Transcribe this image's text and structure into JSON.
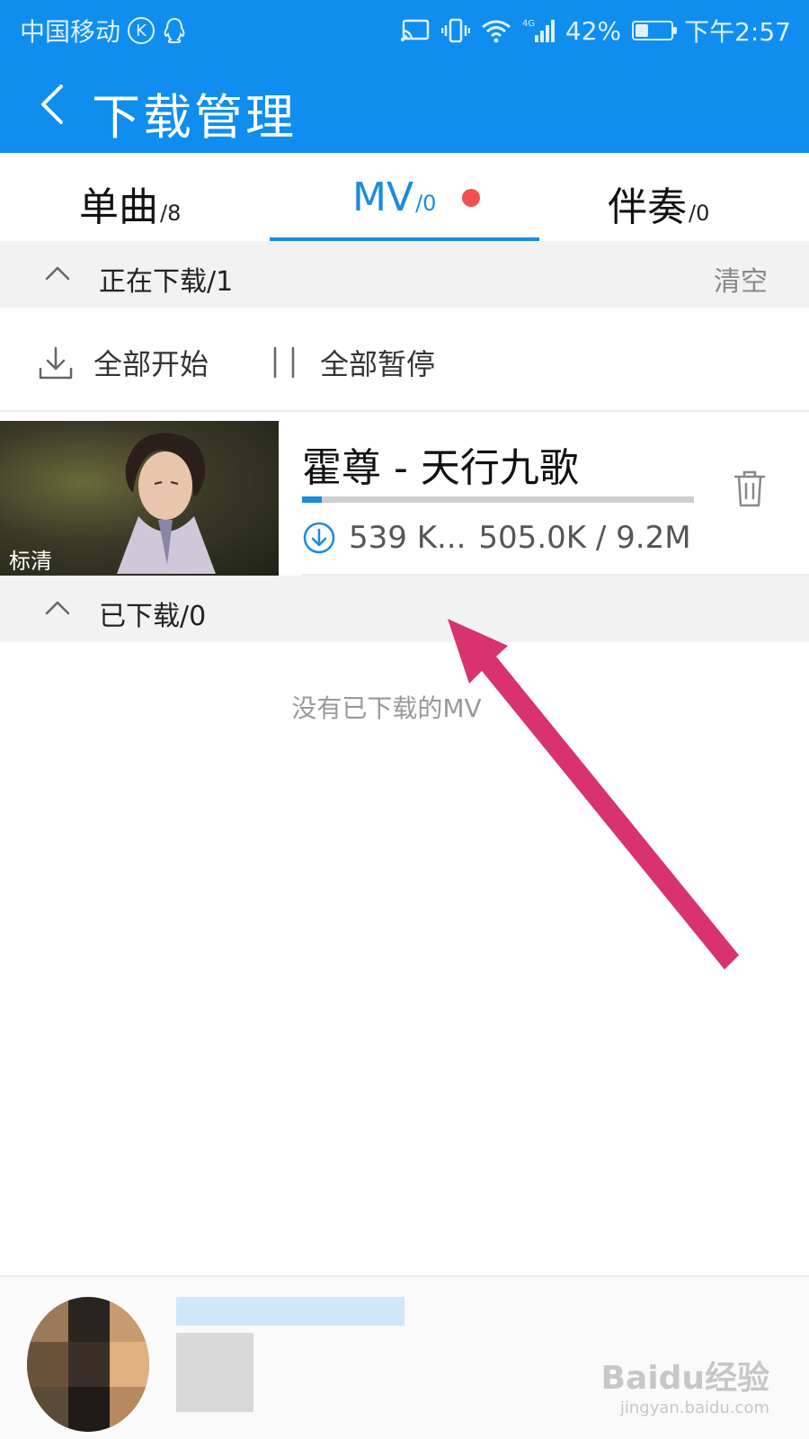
{
  "status_bar": {
    "carrier": "中国移动",
    "k_badge": "K",
    "battery_text": "42%",
    "battery_level": 0.42,
    "time": "下午2:57"
  },
  "title_bar": {
    "title": "下载管理"
  },
  "tabs": [
    {
      "label": "单曲",
      "count": "/8"
    },
    {
      "label": "MV",
      "count": "/0",
      "active": true,
      "has_dot": true
    },
    {
      "label": "伴奏",
      "count": "/0"
    }
  ],
  "downloading_section": {
    "label": "正在下载/1",
    "clear_label": "清空"
  },
  "controls": {
    "start_all": "全部开始",
    "pause_all": "全部暂停"
  },
  "download_item": {
    "title": "霍尊 - 天行九歌",
    "quality_badge": "标清",
    "speed": "539 K...",
    "size_progress": "505.0K / 9.2M",
    "progress_fraction": 0.05
  },
  "downloaded_section": {
    "label": "已下载/0",
    "empty_text": "没有已下载的MV"
  },
  "watermark": {
    "brand": "Baidu经验",
    "url": "jingyan.baidu.com"
  },
  "colors": {
    "header_blue": "#0f8ef0",
    "accent_blue": "#1a8be0",
    "dot_red": "#f05050",
    "annotation_arrow": "#d8336f"
  },
  "icons": {
    "back": "chevron-left-icon",
    "collapse": "chevron-up-icon",
    "download_all": "download-tray-icon",
    "pause_all": "pause-bars-icon",
    "download_status": "download-circle-icon",
    "delete": "trash-icon"
  }
}
